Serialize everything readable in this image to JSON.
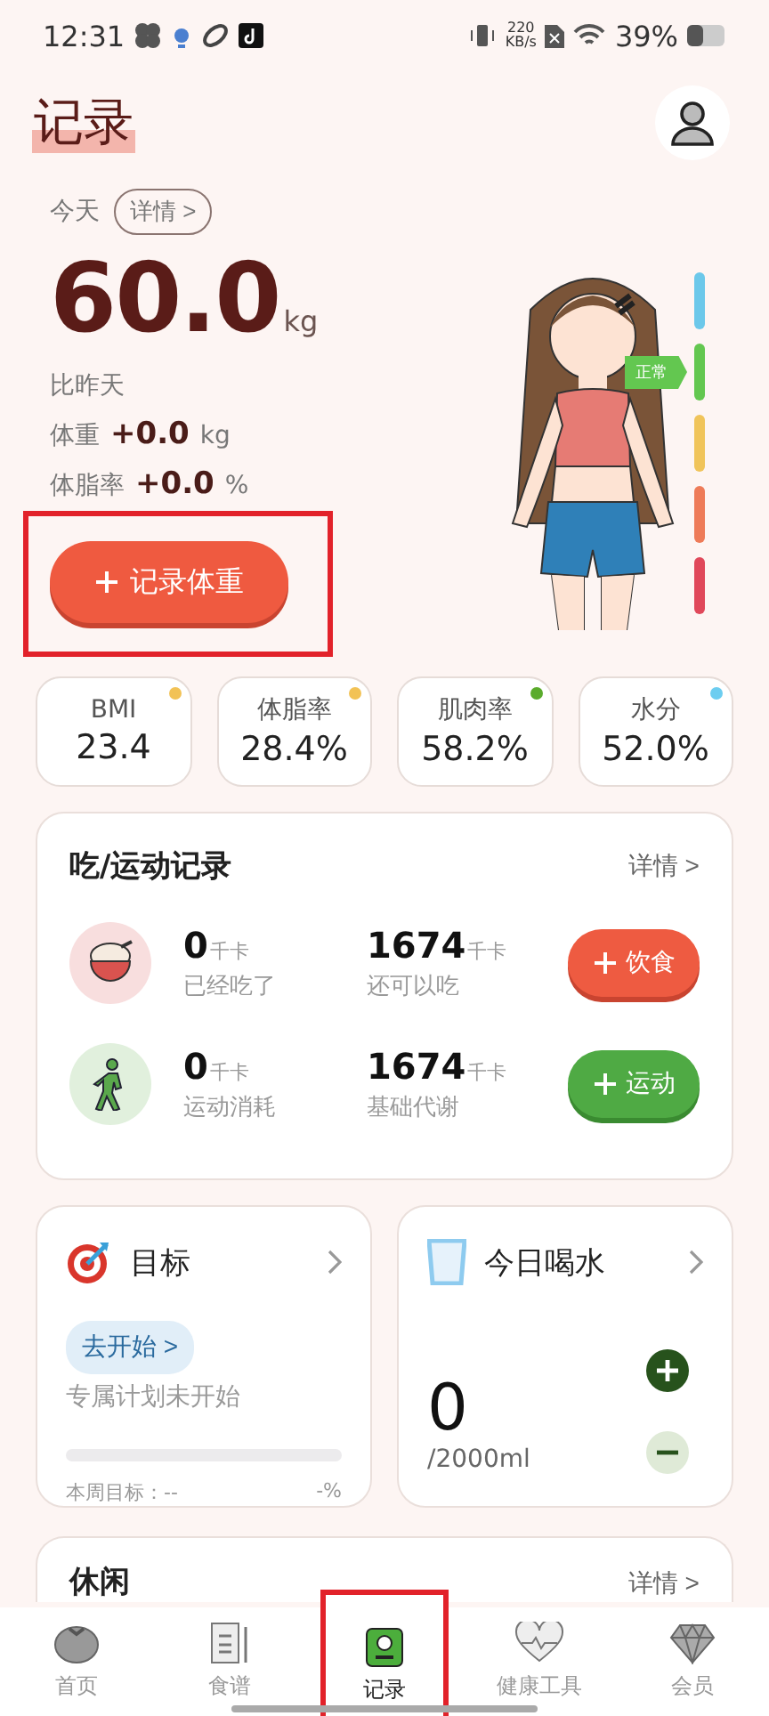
{
  "status_bar": {
    "time": "12:31",
    "speed_value": "220",
    "speed_unit": "KB/s",
    "battery": "39%"
  },
  "header": {
    "title": "记录"
  },
  "weight": {
    "day": "今天",
    "details": "详情 >",
    "value": "60.0",
    "unit": "kg",
    "compare_label": "比昨天",
    "changes": [
      {
        "label": "体重",
        "value": "+0.0",
        "unit": "kg"
      },
      {
        "label": "体脂率",
        "value": "+0.0",
        "unit": "%"
      }
    ],
    "button": "记录体重",
    "scale": [
      {
        "color": "#6cc8ea",
        "selected": false
      },
      {
        "color": "#63c750",
        "selected": true
      },
      {
        "color": "#f0c45a",
        "selected": false
      },
      {
        "color": "#ee7b58",
        "selected": false
      },
      {
        "color": "#e0485a",
        "selected": false
      }
    ],
    "scale_label": "正常"
  },
  "metrics": [
    {
      "label": "BMI",
      "value": "23.4",
      "color": "#f2c255"
    },
    {
      "label": "体脂率",
      "value": "28.4%",
      "color": "#f2c255"
    },
    {
      "label": "肌肉率",
      "value": "58.2%",
      "color": "#5aab2c"
    },
    {
      "label": "水分",
      "value": "52.0%",
      "color": "#6ccdf0"
    }
  ],
  "intake": {
    "title": "吃/运动记录",
    "details": "详情 >",
    "rows": [
      {
        "kind": "food",
        "stats": [
          {
            "value": "0",
            "unit": "千卡",
            "label": "已经吃了"
          },
          {
            "value": "1674",
            "unit": "千卡",
            "label": "还可以吃"
          }
        ],
        "button": "饮食"
      },
      {
        "kind": "exercise",
        "stats": [
          {
            "value": "0",
            "unit": "千卡",
            "label": "运动消耗"
          },
          {
            "value": "1674",
            "unit": "千卡",
            "label": "基础代谢"
          }
        ],
        "button": "运动"
      }
    ]
  },
  "goal": {
    "title": "目标",
    "start_button": "去开始 >",
    "status": "专属计划未开始",
    "level": 0,
    "weekly_label": "本周目标：",
    "weekly_value": "--",
    "percent": "-%"
  },
  "water": {
    "title": "今日喝水",
    "amount": "0",
    "target": "/2000ml"
  },
  "leisure": {
    "title": "休闲",
    "details": "详情 >"
  },
  "nav": [
    {
      "label": "首页",
      "selected": false
    },
    {
      "label": "食谱",
      "selected": false
    },
    {
      "label": "记录",
      "selected": true
    },
    {
      "label": "健康工具",
      "selected": false
    },
    {
      "label": "会员",
      "selected": false
    }
  ]
}
